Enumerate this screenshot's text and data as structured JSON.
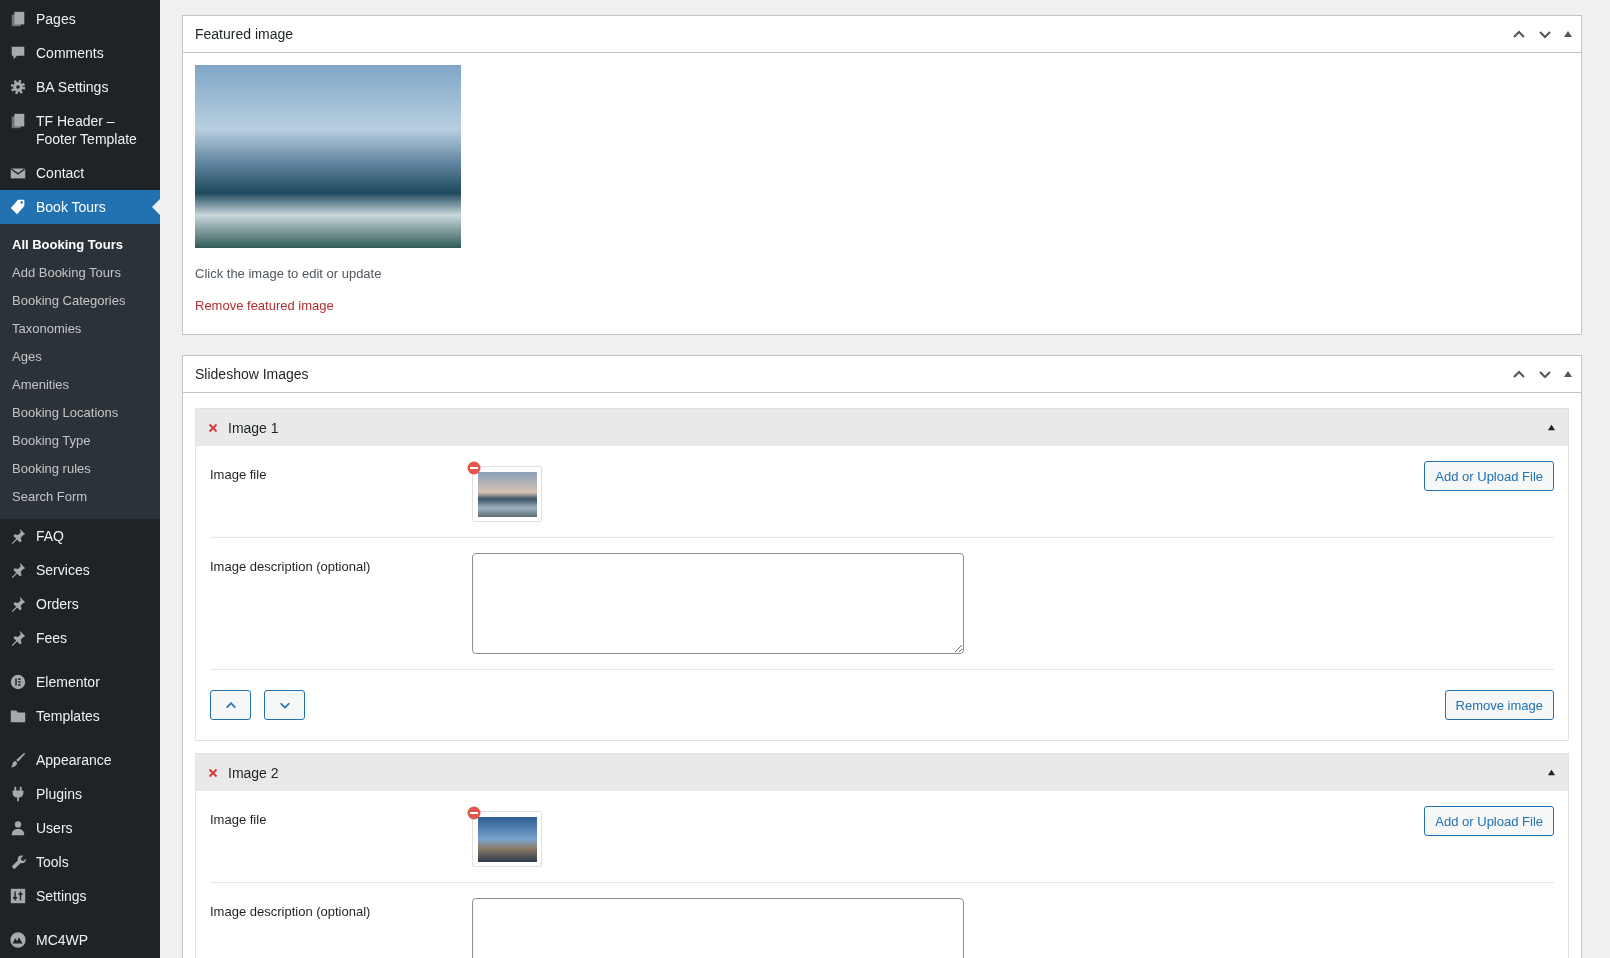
{
  "sidebar": {
    "groups": [
      {
        "items": [
          {
            "label": "Pages",
            "selected": false
          },
          {
            "label": "Comments",
            "selected": false
          },
          {
            "label": "BA Settings",
            "selected": false
          },
          {
            "label": "TF Header – Footer Template",
            "selected": false
          },
          {
            "label": "Contact",
            "selected": false
          },
          {
            "label": "Book Tours",
            "selected": true,
            "submenu": [
              {
                "label": "All Booking Tours",
                "selected": true
              },
              {
                "label": "Add Booking Tours",
                "selected": false
              },
              {
                "label": "Booking Categories",
                "selected": false
              },
              {
                "label": "Taxonomies",
                "selected": false
              },
              {
                "label": "Ages",
                "selected": false
              },
              {
                "label": "Amenities",
                "selected": false
              },
              {
                "label": "Booking Locations",
                "selected": false
              },
              {
                "label": "Booking Type",
                "selected": false
              },
              {
                "label": "Booking rules",
                "selected": false
              },
              {
                "label": "Search Form",
                "selected": false
              }
            ]
          }
        ]
      },
      {
        "items": [
          {
            "label": "FAQ",
            "selected": false
          },
          {
            "label": "Services",
            "selected": false
          },
          {
            "label": "Orders",
            "selected": false
          },
          {
            "label": "Fees",
            "selected": false
          }
        ]
      },
      {
        "items": [
          {
            "label": "Elementor",
            "selected": false
          },
          {
            "label": "Templates",
            "selected": false
          }
        ]
      },
      {
        "items": [
          {
            "label": "Appearance",
            "selected": false
          },
          {
            "label": "Plugins",
            "selected": false
          },
          {
            "label": "Users",
            "selected": false
          },
          {
            "label": "Tools",
            "selected": false
          },
          {
            "label": "Settings",
            "selected": false
          }
        ]
      },
      {
        "items": [
          {
            "label": "MC4WP",
            "selected": false
          }
        ]
      }
    ]
  },
  "featured_image": {
    "title": "Featured image",
    "hint": "Click the image to edit or update",
    "remove_link": "Remove featured image"
  },
  "slideshow": {
    "title": "Slideshow Images",
    "images": [
      {
        "title": "Image 1",
        "expanded": true,
        "file_label": "Image file",
        "upload_button": "Add or Upload File",
        "description_label": "Image description (optional)",
        "remove_button": "Remove image"
      },
      {
        "title": "Image 2",
        "expanded": true,
        "file_label": "Image file",
        "upload_button": "Add or Upload File",
        "description_label": "Image description (optional)"
      }
    ]
  }
}
